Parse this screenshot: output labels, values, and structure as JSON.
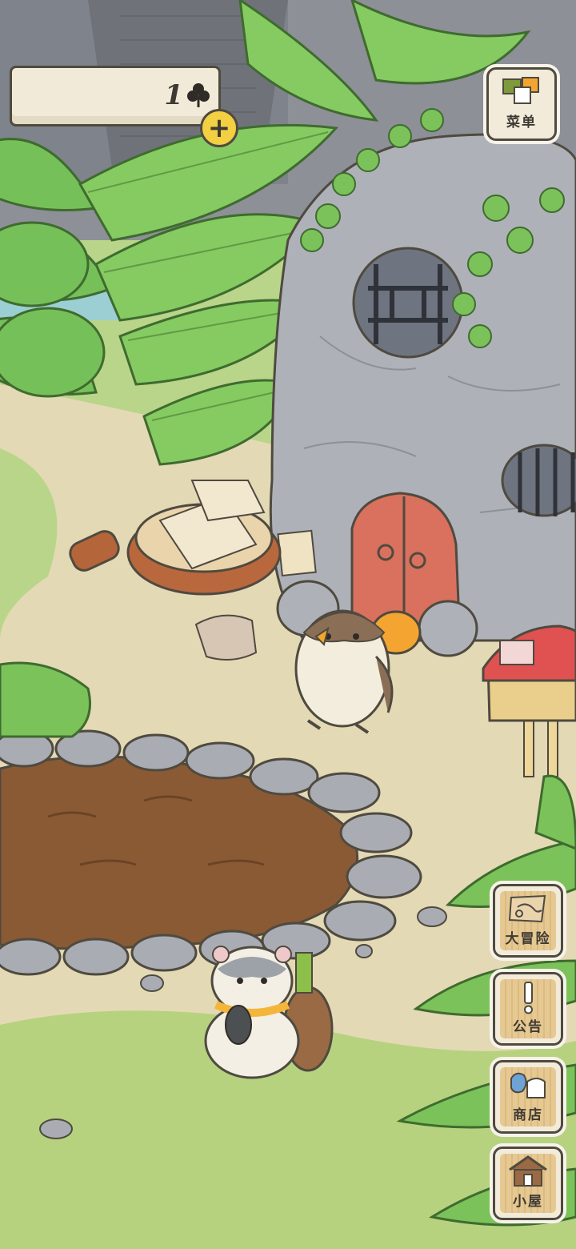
{
  "hud": {
    "clover_count": "1",
    "clover_icon": "clover-icon",
    "plus_label": "+"
  },
  "menu": {
    "label": "菜单",
    "icon": "menu-cards-icon"
  },
  "side_buttons": [
    {
      "label": "大冒险",
      "icon": "map-icon"
    },
    {
      "label": "公告",
      "icon": "exclamation-icon"
    },
    {
      "label": "商店",
      "icon": "shop-bag-icon"
    },
    {
      "label": "小屋",
      "icon": "house-icon"
    }
  ],
  "colors": {
    "ui_border": "#4f4a3f",
    "panel_bg": "#f1ead8",
    "plus_yellow": "#f3cf42",
    "button_wood": "#e6c892",
    "door_red": "#d9715e",
    "mailbox_red": "#e05252"
  }
}
